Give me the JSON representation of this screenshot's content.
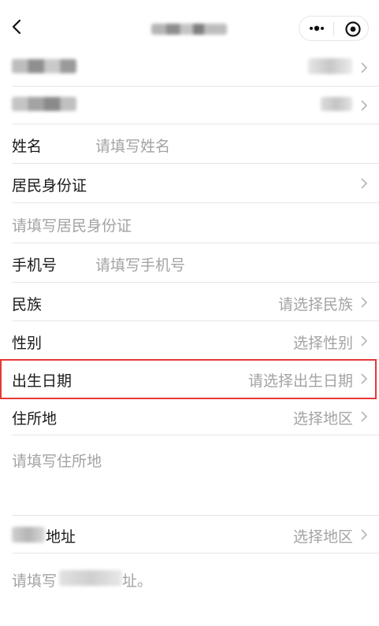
{
  "nav": {
    "back_icon": "chevron-left-icon",
    "more_icon": "more-dots-icon",
    "close_icon": "target-close-icon"
  },
  "form": {
    "name": {
      "label": "姓名",
      "placeholder": "请填写姓名"
    },
    "id_type": {
      "label": "居民身份证"
    },
    "id_number": {
      "placeholder": "请填写居民身份证"
    },
    "phone": {
      "label": "手机号",
      "placeholder": "请填写手机号"
    },
    "ethnicity": {
      "label": "民族",
      "value": "请选择民族"
    },
    "gender": {
      "label": "性别",
      "value": "选择性别"
    },
    "birthdate": {
      "label": "出生日期",
      "value": "请选择出生日期"
    },
    "residence": {
      "label": "住所地",
      "value": "选择地区",
      "detail_placeholder": "请填写住所地"
    },
    "address": {
      "label": "地址",
      "value": "选择地区",
      "detail_placeholder_start": "请填写",
      "detail_placeholder_end": "址。"
    }
  },
  "colors": {
    "highlight": "#e53935",
    "placeholder": "#a3a3a3",
    "divider": "#e6e6e6"
  }
}
